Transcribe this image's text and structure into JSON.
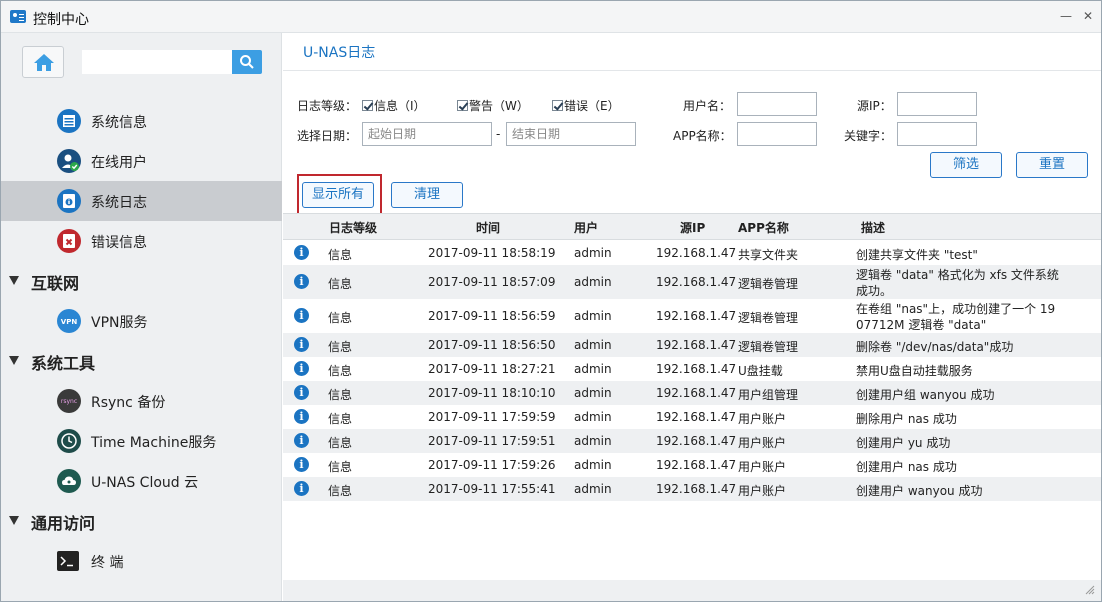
{
  "window": {
    "title": "控制中心",
    "minimize_glyph": "—",
    "close_glyph": "✕"
  },
  "sidebar": {
    "home_icon": "home-icon",
    "search_icon": "search-icon",
    "search_value": "",
    "items": [
      {
        "label": "系统信息",
        "icon": "system-info-icon",
        "color": "#1b74c2"
      },
      {
        "label": "在线用户",
        "icon": "online-user-icon",
        "color": "#1b74c2"
      },
      {
        "label": "系统日志",
        "icon": "system-log-icon",
        "color": "#1b74c2",
        "active": true
      },
      {
        "label": "错误信息",
        "icon": "error-info-icon",
        "color": "#c0282e"
      }
    ],
    "groups": [
      {
        "label": "互联网",
        "items": [
          {
            "label": "VPN服务",
            "icon": "vpn-icon"
          }
        ]
      },
      {
        "label": "系统工具",
        "items": [
          {
            "label": "Rsync 备份",
            "icon": "rsync-icon"
          },
          {
            "label": "Time Machine服务",
            "icon": "time-machine-icon"
          },
          {
            "label": "U-NAS Cloud 云",
            "icon": "cloud-icon"
          }
        ]
      },
      {
        "label": "通用访问",
        "items": [
          {
            "label": "终 端",
            "icon": "terminal-icon"
          }
        ]
      }
    ]
  },
  "main": {
    "title": "U-NAS日志",
    "filters": {
      "level_label": "日志等级：",
      "level_info": "信息（I）",
      "level_warn": "警告（W）",
      "level_error": "错误（E）",
      "date_label": "选择日期：",
      "start_date_placeholder": "起始日期",
      "date_separator": "-",
      "end_date_placeholder": "结束日期",
      "username_label": "用户名：",
      "source_ip_label": "源IP：",
      "app_name_label": "APP名称：",
      "keyword_label": "关键字："
    },
    "buttons": {
      "filter": "筛选",
      "reset": "重置",
      "show_all": "显示所有",
      "clear": "清理"
    },
    "table": {
      "headers": [
        "日志等级",
        "时间",
        "用户",
        "源IP",
        "APP名称",
        "描述"
      ],
      "rows": [
        {
          "level": "信息",
          "time": "2017-09-11 18:58:19",
          "user": "admin",
          "ip": "192.168.1.47",
          "app": "共享文件夹",
          "desc": "创建共享文件夹 \"test\"",
          "desc2": ""
        },
        {
          "level": "信息",
          "time": "2017-09-11 18:57:09",
          "user": "admin",
          "ip": "192.168.1.47",
          "app": "逻辑卷管理",
          "desc": "逻辑卷 \"data\" 格式化为 xfs 文件系统",
          "desc2": "成功。"
        },
        {
          "level": "信息",
          "time": "2017-09-11 18:56:59",
          "user": "admin",
          "ip": "192.168.1.47",
          "app": "逻辑卷管理",
          "desc": "在卷组 \"nas\"上，成功创建了一个 19",
          "desc2": "07712M 逻辑卷 \"data\""
        },
        {
          "level": "信息",
          "time": "2017-09-11 18:56:50",
          "user": "admin",
          "ip": "192.168.1.47",
          "app": "逻辑卷管理",
          "desc": "删除卷 \"/dev/nas/data\"成功",
          "desc2": ""
        },
        {
          "level": "信息",
          "time": "2017-09-11 18:27:21",
          "user": "admin",
          "ip": "192.168.1.47",
          "app": "U盘挂载",
          "desc": "禁用U盘自动挂载服务",
          "desc2": ""
        },
        {
          "level": "信息",
          "time": "2017-09-11 18:10:10",
          "user": "admin",
          "ip": "192.168.1.47",
          "app": "用户组管理",
          "desc": "创建用户组 wanyou 成功",
          "desc2": ""
        },
        {
          "level": "信息",
          "time": "2017-09-11 17:59:59",
          "user": "admin",
          "ip": "192.168.1.47",
          "app": "用户账户",
          "desc": "删除用户 nas 成功",
          "desc2": ""
        },
        {
          "level": "信息",
          "time": "2017-09-11 17:59:51",
          "user": "admin",
          "ip": "192.168.1.47",
          "app": "用户账户",
          "desc": "创建用户 yu 成功",
          "desc2": ""
        },
        {
          "level": "信息",
          "time": "2017-09-11 17:59:26",
          "user": "admin",
          "ip": "192.168.1.47",
          "app": "用户账户",
          "desc": "创建用户 nas 成功",
          "desc2": ""
        },
        {
          "level": "信息",
          "time": "2017-09-11 17:55:41",
          "user": "admin",
          "ip": "192.168.1.47",
          "app": "用户账户",
          "desc": "创建用户 wanyou 成功",
          "desc2": ""
        }
      ]
    }
  }
}
